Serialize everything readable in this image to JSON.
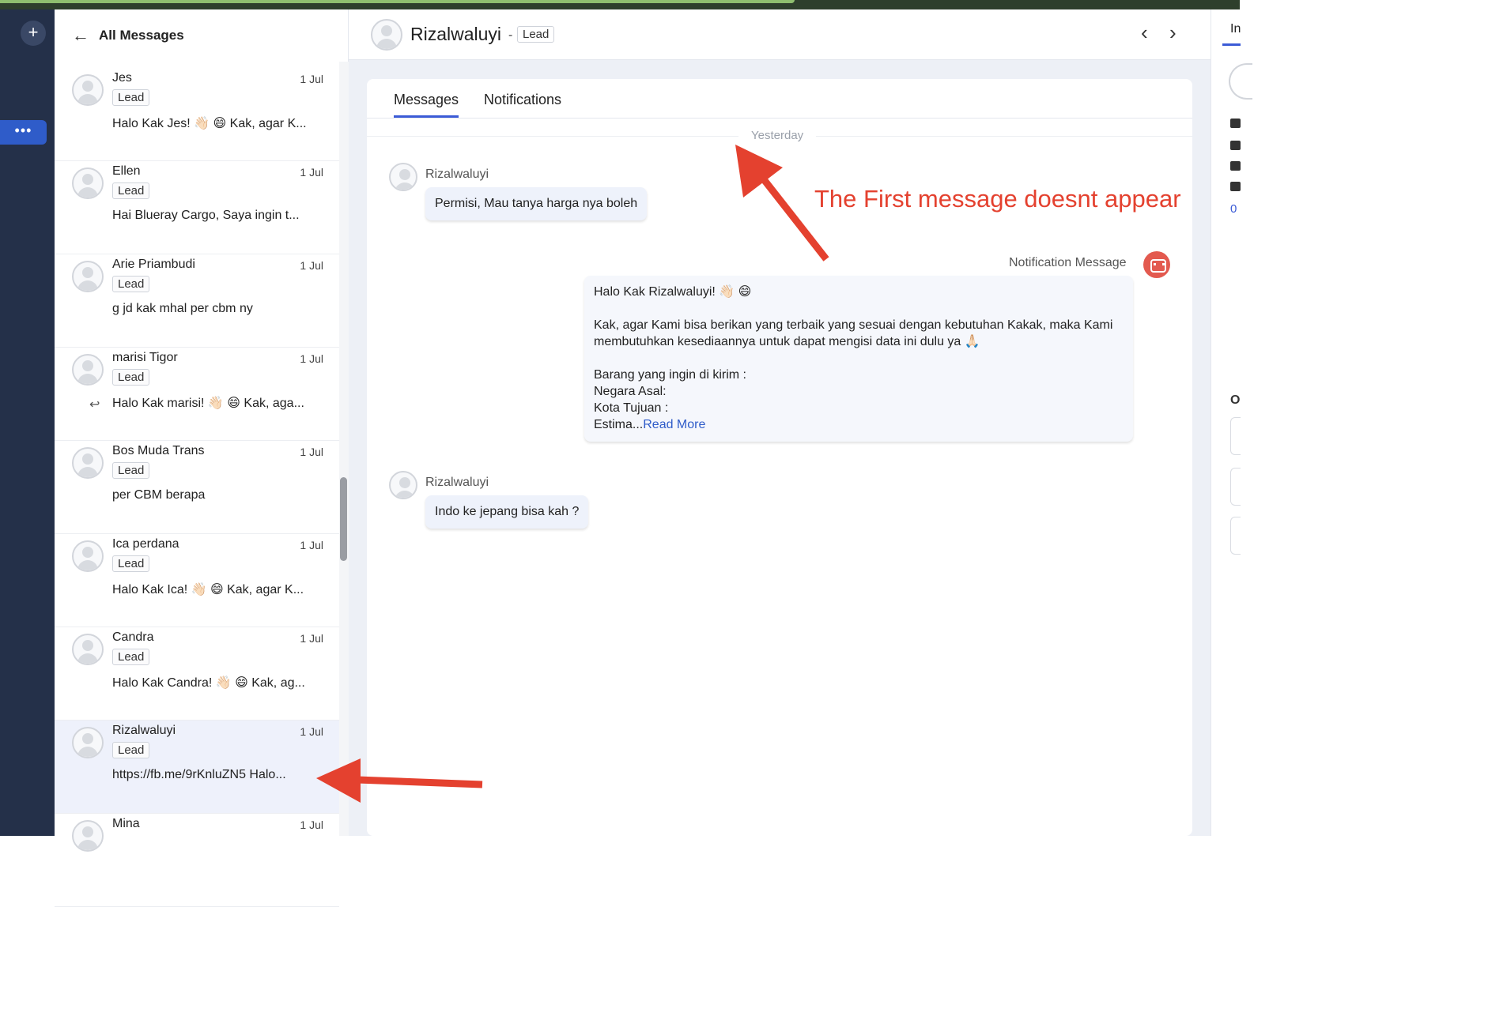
{
  "sidebar": {
    "back_label": "All Messages",
    "items": [
      {
        "name": "Jes",
        "date": "1 Jul",
        "badge": "Lead",
        "preview": "Halo Kak Jes! 👋🏻 😄 Kak, agar K...",
        "replied": false,
        "active": false
      },
      {
        "name": "Ellen",
        "date": "1 Jul",
        "badge": "Lead",
        "preview": "Hai Blueray Cargo, Saya ingin t...",
        "replied": false,
        "active": false
      },
      {
        "name": "Arie Priambudi",
        "date": "1 Jul",
        "badge": "Lead",
        "preview": "g jd kak mhal per cbm ny",
        "replied": false,
        "active": false
      },
      {
        "name": "marisi Tigor",
        "date": "1 Jul",
        "badge": "Lead",
        "preview": "Halo Kak marisi! 👋🏻 😄 Kak, aga...",
        "replied": true,
        "active": false
      },
      {
        "name": "Bos Muda Trans",
        "date": "1 Jul",
        "badge": "Lead",
        "preview": "per CBM berapa",
        "replied": false,
        "active": false
      },
      {
        "name": "Ica perdana",
        "date": "1 Jul",
        "badge": "Lead",
        "preview": "Halo Kak Ica! 👋🏻 😄 Kak, agar K...",
        "replied": false,
        "active": false
      },
      {
        "name": "Candra",
        "date": "1 Jul",
        "badge": "Lead",
        "preview": "Halo Kak Candra! 👋🏻 😄 Kak, ag...",
        "replied": false,
        "active": false
      },
      {
        "name": "Rizalwaluyi",
        "date": "1 Jul",
        "badge": "Lead",
        "preview": "https://fb.me/9rKnluZN5 Halo...",
        "replied": false,
        "active": true
      },
      {
        "name": "Mina",
        "date": "1 Jul",
        "badge": "",
        "preview": "",
        "replied": false,
        "active": false
      }
    ]
  },
  "header": {
    "contact_name": "Rizalwaluyi",
    "separator": "-",
    "badge": "Lead",
    "prev_icon": "‹",
    "next_icon": "›"
  },
  "tabs": {
    "messages": "Messages",
    "notifications": "Notifications"
  },
  "conversation": {
    "day_label": "Yesterday",
    "msg1": {
      "sender": "Rizalwaluyi",
      "text": "Permisi, Mau tanya harga nya boleh"
    },
    "notification": {
      "label": "Notification Message",
      "line1": "Halo Kak Rizalwaluyi! 👋🏻 😄",
      "line2": "Kak, agar Kami bisa berikan yang terbaik yang sesuai dengan kebutuhan Kakak, maka Kami",
      "line3": "membutuhkan kesediaannya untuk dapat mengisi data ini dulu ya 🙏🏻",
      "line4": "Barang yang ingin di kirim :",
      "line5": "Negara Asal:",
      "line6": "Kota Tujuan :",
      "line7": "Estima...",
      "read_more": "Read More"
    },
    "msg2": {
      "sender": "Rizalwaluyi",
      "text": "Indo ke jepang bisa kah ?"
    }
  },
  "annotation": {
    "text": "The First message doesnt appear",
    "color": "#e4412f"
  },
  "right_panel": {
    "tab_label": "In",
    "link_label": "0",
    "section_label": "O"
  },
  "icons": {
    "add": "plus-icon",
    "more": "ellipsis-icon",
    "back": "arrow-left-icon",
    "reply": "reply-icon",
    "bot": "bot-icon"
  },
  "colors": {
    "nav_bg": "#243049",
    "accent": "#3b5bd6",
    "bot_button": "#e35a4f",
    "bubble_bg": "#eef2fb"
  },
  "ui": {
    "plus_glyph": "+",
    "more_glyph": "•••",
    "back_glyph": "←",
    "reply_glyph": "↩"
  }
}
